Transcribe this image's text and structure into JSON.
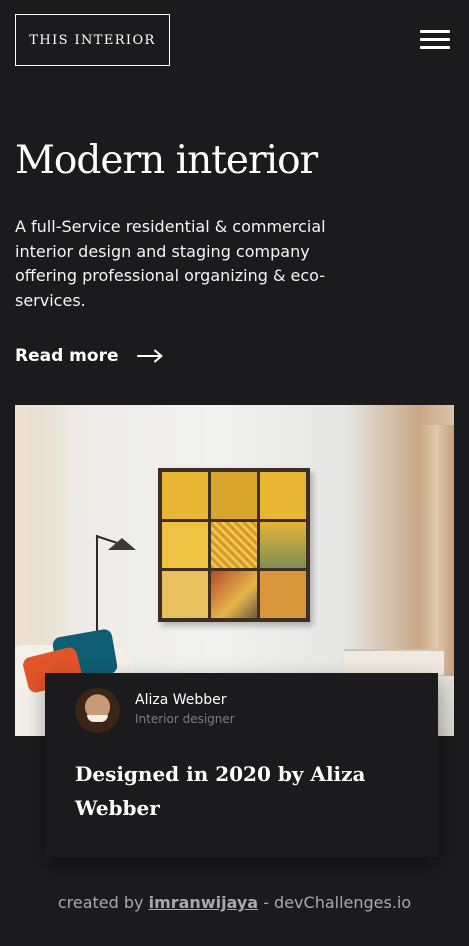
{
  "header": {
    "logo_text": "THIS INTERIOR",
    "menu_icon": "hamburger-menu-icon"
  },
  "hero": {
    "title": "Modern interior",
    "description": "A full-Service residential & commercial interior design and staging company offering professional organizing & eco-services.",
    "read_more_label": "Read more",
    "read_more_icon": "arrow-right-icon"
  },
  "card": {
    "author_name": "Aliza Webber",
    "author_role": "Interior designer",
    "title": "Designed in 2020 by Aliza Webber"
  },
  "footer": {
    "prefix": "created by",
    "author_link": "imranwijaya",
    "suffix": "- devChallenges.io"
  },
  "colors": {
    "background": "#1b1a1d",
    "text": "#ffffff",
    "muted": "#7c7c80"
  }
}
